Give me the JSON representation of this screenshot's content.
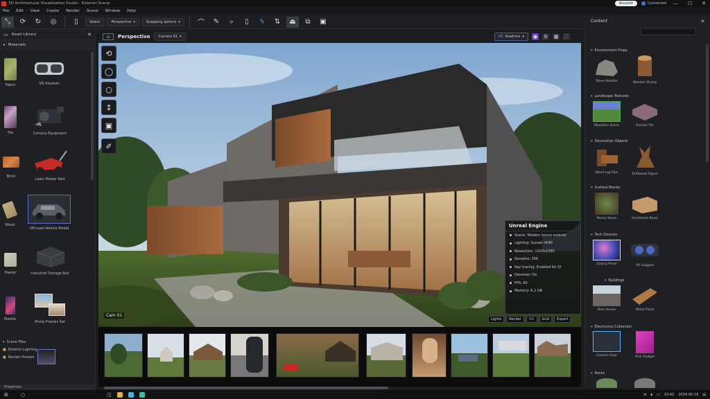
{
  "window": {
    "title": "3D Architectural Visualization Studio - Exterior Scene",
    "account": {
      "label": "Account",
      "status": "Connected"
    },
    "controls": [
      "—",
      "☐",
      "✕"
    ]
  },
  "menu": [
    "File",
    "Edit",
    "View",
    "Create",
    "Render",
    "Scene",
    "Window",
    "Help"
  ],
  "toolbar": {
    "mode_dropdown": "Select",
    "view_dropdown": "Perspective",
    "snap_dropdown": "Snapping options"
  },
  "left_panel": {
    "header": "Asset Library",
    "subheader": "Materials",
    "items": [
      {
        "label": "Fabric"
      },
      {
        "label": "VR Headset"
      },
      {
        "label": "Tile"
      },
      {
        "label": "Camera Equipment"
      },
      {
        "label": "Brick"
      },
      {
        "label": "Lawn Mower Red"
      },
      {
        "label": "Wood"
      },
      {
        "label": "Off-road Vehicle Model"
      },
      {
        "label": "Plaster"
      },
      {
        "label": "Industrial Storage Box"
      },
      {
        "label": "Marble"
      },
      {
        "label": "Photo Frames Set"
      }
    ],
    "folder": [
      "Scene Files",
      "Exterior Lighting",
      "Render Presets"
    ],
    "bottom_label": "Properties"
  },
  "viewport": {
    "tag": "3D",
    "title": "Perspective",
    "view_dropdown": "Camera 01",
    "render_dropdown": "Realtime",
    "badge": "Cam 01",
    "chips": [
      "Lights",
      "Render",
      "HD",
      "Grid",
      "Export"
    ],
    "info_panel": {
      "title": "Unreal Engine",
      "rows": [
        "Scene: Modern house exterior",
        "Lighting: Sunset HDRI",
        "Resolution: 1920x1080",
        "Samples: 256",
        "Ray tracing: Enabled for GI",
        "Denoiser: On",
        "FPS: 60",
        "Memory: 6.2 GB"
      ]
    }
  },
  "right_panel": {
    "header": "Content",
    "sections": [
      {
        "title": "Environment Props",
        "items": [
          {
            "label": "Stone Boulder"
          },
          {
            "label": "Wooden Stump"
          }
        ]
      },
      {
        "title": "Landscape Textures",
        "items": [
          {
            "label": "Mountain Scene"
          },
          {
            "label": "Granite Tile"
          }
        ]
      },
      {
        "title": "Decoration Objects",
        "items": [
          {
            "label": "Wood Log Pipe"
          },
          {
            "label": "Driftwood Figure"
          }
        ]
      },
      {
        "title": "Surface Blocks",
        "items": [
          {
            "label": "Mossy Stone"
          },
          {
            "label": "Sandstone Block"
          }
        ]
      },
      {
        "title": "Tech Devices",
        "items": [
          {
            "label": "Galaxy Panel"
          },
          {
            "label": "VR Goggles"
          }
        ]
      },
      {
        "title": "Buildings",
        "items": [
          {
            "label": "Barn House"
          },
          {
            "label": "Wood Plank"
          }
        ]
      },
      {
        "title": "Electronics Collection",
        "items": [
          {
            "label": "Camera Gear"
          },
          {
            "label": "Pink Gadget"
          }
        ]
      },
      {
        "title": "Rocks"
      }
    ]
  },
  "taskbar": {
    "time": "10:42",
    "date": "2024-05-18"
  }
}
